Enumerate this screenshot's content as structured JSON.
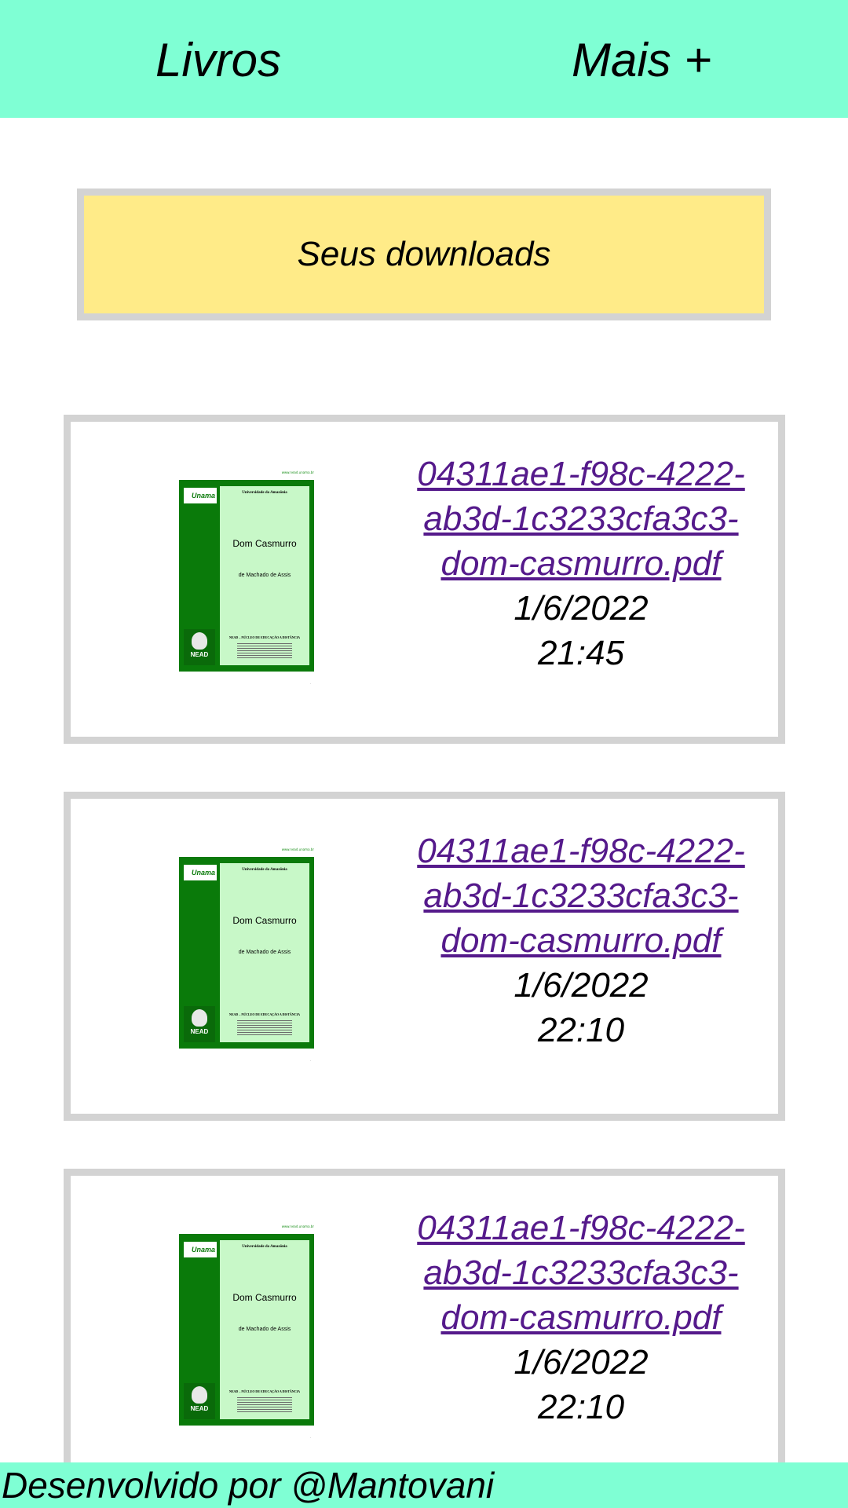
{
  "nav": {
    "books_label": "Livros",
    "more_label": "Mais +"
  },
  "downloads": {
    "title": "Seus downloads"
  },
  "items": [
    {
      "file_name": "04311ae1-f98c-4222-ab3d-1c3233cfa3c3-dom-casmurro.pdf",
      "date": "1/6/2022",
      "time": "21:45",
      "cover": {
        "site": "www.nead.unama.br",
        "logo": "Unama",
        "university": "Universidade da Amazônia",
        "title": "Dom Casmurro",
        "author": "de Machado de Assis",
        "nead": "NEAD – NÚCLEO DE EDUCAÇÃO A DISTÂNCIA",
        "owl_text": "NEAD"
      }
    },
    {
      "file_name": "04311ae1-f98c-4222-ab3d-1c3233cfa3c3-dom-casmurro.pdf",
      "date": "1/6/2022",
      "time": "22:10",
      "cover": {
        "site": "www.nead.unama.br",
        "logo": "Unama",
        "university": "Universidade da Amazônia",
        "title": "Dom Casmurro",
        "author": "de Machado de Assis",
        "nead": "NEAD – NÚCLEO DE EDUCAÇÃO A DISTÂNCIA",
        "owl_text": "NEAD"
      }
    },
    {
      "file_name": "04311ae1-f98c-4222-ab3d-1c3233cfa3c3-dom-casmurro.pdf",
      "date": "1/6/2022",
      "time": "22:10",
      "cover": {
        "site": "www.nead.unama.br",
        "logo": "Unama",
        "university": "Universidade da Amazônia",
        "title": "Dom Casmurro",
        "author": "de Machado de Assis",
        "nead": "NEAD – NÚCLEO DE EDUCAÇÃO A DISTÂNCIA",
        "owl_text": "NEAD"
      }
    }
  ],
  "footer": {
    "text": "Desenvolvido por @Mantovani"
  },
  "colors": {
    "header_bg": "#7fffd4",
    "downloads_bg": "#ffeb88",
    "border": "#d3d3d3",
    "link": "#551a8b"
  }
}
